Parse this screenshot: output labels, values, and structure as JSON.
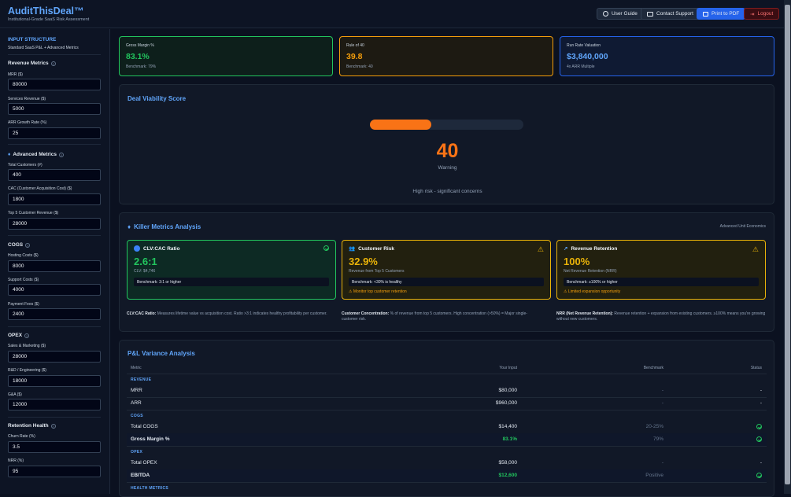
{
  "header": {
    "title": "AuditThisDeal™",
    "subtitle": "Institutional-Grade SaaS Risk Assessment",
    "buttons": {
      "guide": "User Guide",
      "support": "Contact Support",
      "print": "Print to PDF",
      "logout": "Logout"
    }
  },
  "sidebar": {
    "section_title": "INPUT STRUCTURE",
    "section_sub": "Standard SaaS P&L + Advanced Metrics",
    "revenue": {
      "title": "Revenue Metrics",
      "mrr_label": "MRR ($)",
      "mrr": "80000",
      "services_label": "Services Revenue ($)",
      "services": "5000",
      "growth_label": "ARR Growth Rate (%)",
      "growth": "25"
    },
    "advanced": {
      "title": "Advanced Metrics",
      "customers_label": "Total Customers (#)",
      "customers": "400",
      "cac_label": "CAC (Customer Acquisition Cost) ($)",
      "cac": "1800",
      "top5_label": "Top 5 Customer Revenue ($)",
      "top5": "28000"
    },
    "cogs": {
      "title": "COGS",
      "hosting_label": "Hosting Costs ($)",
      "hosting": "8000",
      "support_label": "Support Costs ($)",
      "support": "4000",
      "payment_label": "Payment Fees ($)",
      "payment": "2400"
    },
    "opex": {
      "title": "OPEX",
      "sm_label": "Sales & Marketing ($)",
      "sm": "28000",
      "rd_label": "R&D / Engineering ($)",
      "rd": "18000",
      "ga_label": "G&A ($)",
      "ga": "12000"
    },
    "retention": {
      "title": "Retention Health",
      "churn_label": "Churn Rate (%)",
      "churn": "3.5",
      "nrr_label": "NRR (%)",
      "nrr": "95"
    }
  },
  "kpis": [
    {
      "label": "Gross Margin %",
      "value": "83.1%",
      "sub": "Benchmark: 79%",
      "color": "#22c55e"
    },
    {
      "label": "Rule of 40",
      "value": "39.8",
      "sub": "Benchmark: 40",
      "color": "#f59e0b"
    },
    {
      "label": "Run Rate Valuation",
      "value": "$3,840,000",
      "sub": "4x ARR Multiple",
      "color": "#60a5fa"
    }
  ],
  "viability": {
    "title": "Deal Viability Score",
    "score": "40",
    "progress": 0.4,
    "status": "Warning",
    "message": "High risk - significant concerns",
    "color": "#f97316"
  },
  "killer": {
    "title": "Killer Metrics Analysis",
    "badge": "Advanced Unit Economics",
    "cards": [
      {
        "title": "CLV:CAC Ratio",
        "value": "2.6:1",
        "sub": "CLV: $4,746",
        "bench": "Benchmark: 3:1 or higher",
        "warn": "",
        "color": "#22c55e"
      },
      {
        "title": "Customer Risk",
        "value": "32.9%",
        "sub": "Revenue from Top 5 Customers",
        "bench": "Benchmark: <30% is healthy",
        "warn": "⚠ Monitor top customer retention",
        "color": "#eab308"
      },
      {
        "title": "Revenue Retention",
        "value": "100%",
        "sub": "Net Revenue Retention (NRR)",
        "bench": "Benchmark: ≥100% or higher",
        "warn": "⚠ Limited expansion opportunity",
        "color": "#eab308"
      }
    ],
    "notes": [
      {
        "bold": "CLV:CAC Ratio:",
        "text": " Measures lifetime value vs acquisition cost. Ratio >3:1 indicates healthy profitability per customer."
      },
      {
        "bold": "Customer Concentration:",
        "text": " % of revenue from top 5 customers. High concentration (>50%) = Major single-customer risk."
      },
      {
        "bold": "NRR (Net Revenue Retention):",
        "text": " Revenue retention + expansion from existing customers. ≥100% means you're growing without new customers."
      }
    ]
  },
  "pl": {
    "title": "P&L Variance Analysis",
    "headers": {
      "metric": "Metric",
      "input": "Your Input",
      "benchmark": "Benchmark",
      "status": "Status"
    },
    "sections": {
      "revenue": "REVENUE",
      "cogs": "COGS",
      "opex": "OPEX",
      "health": "HEALTH METRICS"
    },
    "rows": [
      {
        "metric": "MRR",
        "input": "$80,000",
        "benchmark": "-",
        "status": "-"
      },
      {
        "metric": "ARR",
        "input": "$960,000",
        "benchmark": "-",
        "status": "-"
      },
      {
        "metric": "Total COGS",
        "input": "$14,400",
        "benchmark": "20-25%",
        "status": "ok"
      },
      {
        "metric": "Gross Margin %",
        "input": "83.1%",
        "benchmark": "79%",
        "status": "ok"
      },
      {
        "metric": "Total OPEX",
        "input": "$58,000",
        "benchmark": "-",
        "status": "-"
      },
      {
        "metric": "EBITDA",
        "input": "$12,600",
        "benchmark": "Positive",
        "status": "ok"
      }
    ]
  }
}
